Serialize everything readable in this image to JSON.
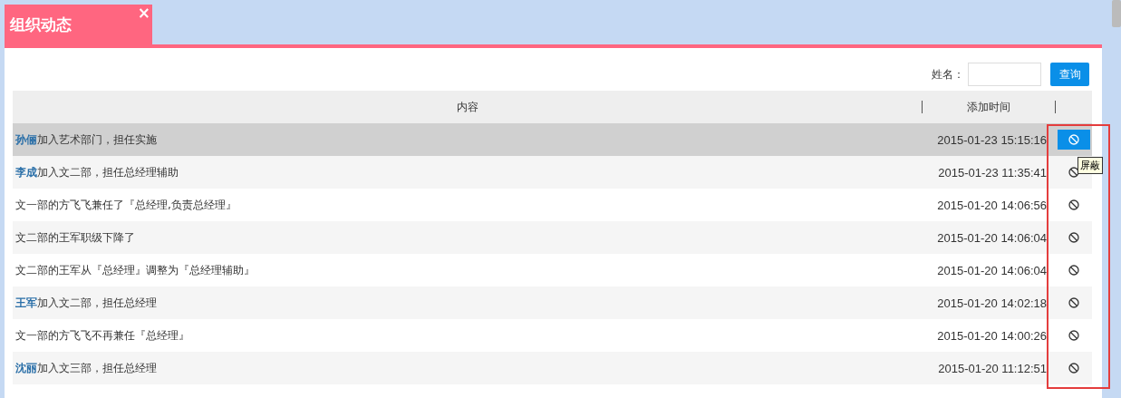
{
  "tab": {
    "title": "组织动态",
    "close": "×",
    "selected": true
  },
  "search": {
    "label": "姓名：",
    "button": "查询"
  },
  "table": {
    "columns": [
      "内容",
      "添加时间"
    ],
    "rows": [
      {
        "name": "孙俪",
        "text": "加入艺术部门，担任实施",
        "time": "2015-01-23 15:15:16",
        "selected": true
      },
      {
        "name": "李成",
        "text": "加入文二部，担任总经理辅助",
        "time": "2015-01-23 11:35:41",
        "selected": false
      },
      {
        "text": "文一部的方飞飞兼任了『总经理,负责总经理』",
        "time": "2015-01-20 14:06:56",
        "selected": false
      },
      {
        "text": "文二部的王军职级下降了",
        "time": "2015-01-20 14:06:04",
        "selected": false
      },
      {
        "text": "文二部的王军从『总经理』调整为『总经理辅助』",
        "time": "2015-01-20 14:06:04",
        "selected": false
      },
      {
        "name": "王军",
        "text": "加入文二部，担任总经理",
        "time": "2015-01-20 14:02:18",
        "selected": false
      },
      {
        "text": "文一部的方飞飞不再兼任『总经理』",
        "time": "2015-01-20 14:00:26",
        "selected": false
      },
      {
        "name": "沈丽",
        "text": "加入文三部，担任总经理",
        "time": "2015-01-20 11:12:51",
        "selected": false
      }
    ]
  },
  "tooltip": "屏蔽"
}
